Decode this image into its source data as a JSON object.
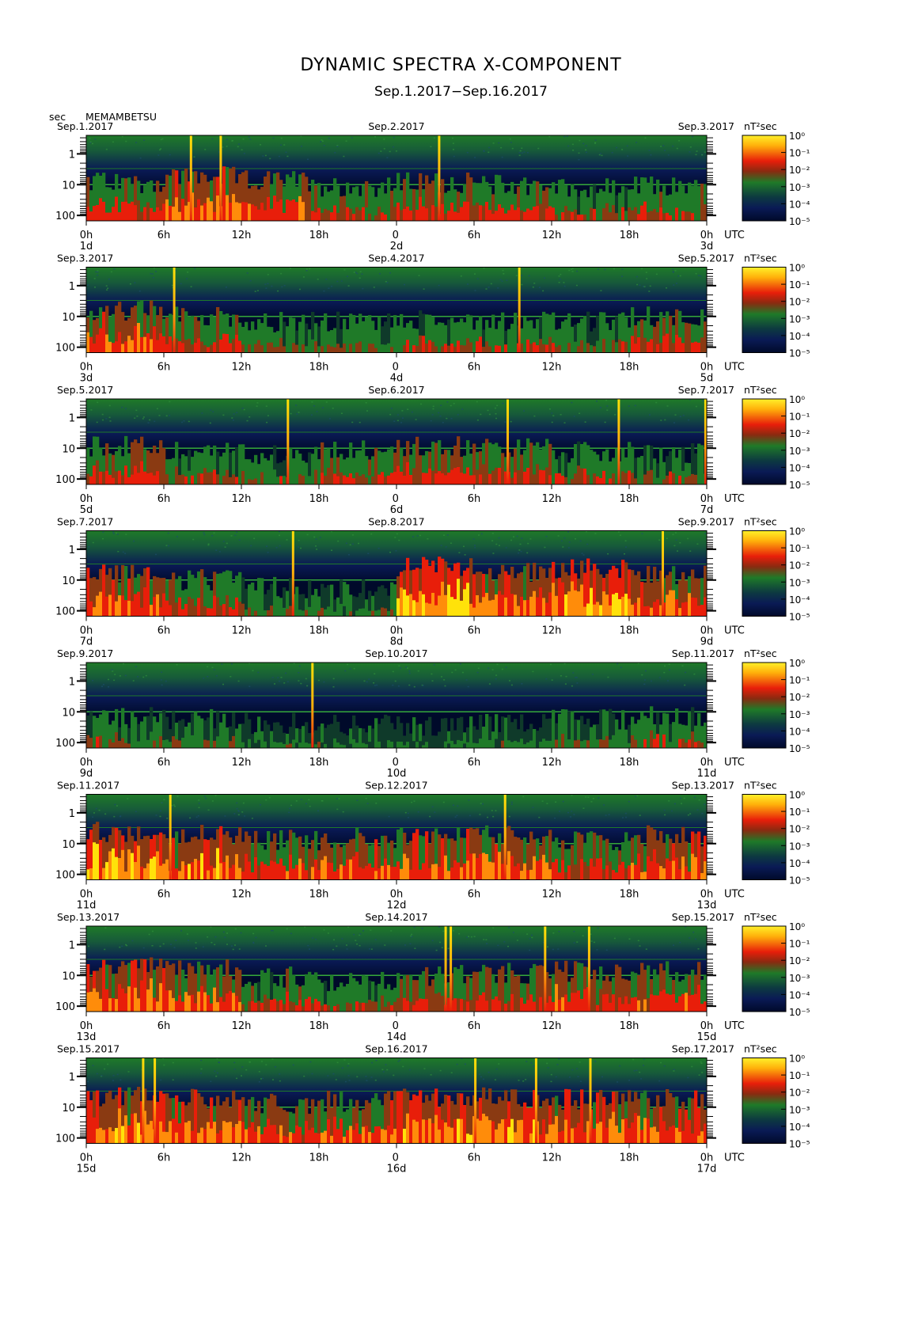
{
  "title": "DYNAMIC SPECTRA X-COMPONENT",
  "subtitle": "Sep.1.2017−Sep.16.2017",
  "y_unit": "sec",
  "station": "MEMAMBETSU",
  "colorbar_unit": "nT²sec",
  "colorbar_ticks": [
    "10⁰",
    "10⁻¹",
    "10⁻²",
    "10⁻³",
    "10⁻⁴",
    "10⁻⁵"
  ],
  "utc_label": "UTC",
  "colors": {
    "background": "#000a2a",
    "low": "#0a1a55",
    "mid": "#1f7a28",
    "high": "#e81e0a",
    "peak": "#ffe20a"
  },
  "chart_data": [
    {
      "type": "heatmap",
      "left_date": "Sep.1.2017",
      "center_date": "Sep.2.2017",
      "right_date": "Sep.3.2017",
      "x_ticks": [
        "0h",
        "6h",
        "12h",
        "18h",
        "0 ",
        "6h",
        "12h",
        "18h",
        "0h"
      ],
      "day_labels": [
        "1d",
        "2d",
        "3d"
      ],
      "y_ticks": [
        "1",
        "10",
        "100"
      ],
      "ylim_sec": [
        0.25,
        150
      ],
      "x_hours": [
        0,
        48
      ],
      "z_range": [
        "10⁻⁵",
        "10⁰"
      ],
      "spikes_hours": [
        8.1,
        10.4,
        27.3
      ],
      "activity": [
        0.55,
        0.7,
        0.6,
        0.45,
        0.55,
        0.5,
        0.4,
        0.45
      ]
    },
    {
      "type": "heatmap",
      "left_date": "Sep.3.2017",
      "center_date": "Sep.4.2017",
      "right_date": "Sep.5.2017",
      "x_ticks": [
        "0h",
        "6h",
        "12h",
        "18h",
        "0 ",
        "6h",
        "12h",
        "18h",
        "0h"
      ],
      "day_labels": [
        "3d",
        "4d",
        "5d"
      ],
      "y_ticks": [
        "1",
        "10",
        "100"
      ],
      "ylim_sec": [
        0.25,
        150
      ],
      "x_hours": [
        0,
        48
      ],
      "z_range": [
        "10⁻⁵",
        "10⁰"
      ],
      "spikes_hours": [
        6.8,
        33.5
      ],
      "activity": [
        0.65,
        0.5,
        0.35,
        0.35,
        0.4,
        0.4,
        0.35,
        0.5
      ]
    },
    {
      "type": "heatmap",
      "left_date": "Sep.5.2017",
      "center_date": "Sep.6.2017",
      "right_date": "Sep.7.2017",
      "x_ticks": [
        "0h",
        "6h",
        "12h",
        "18h",
        "0 ",
        "6h",
        "12h",
        "18h",
        "0h"
      ],
      "day_labels": [
        "5d",
        "6d",
        "7d"
      ],
      "y_ticks": [
        "1",
        "10",
        "100"
      ],
      "ylim_sec": [
        0.25,
        150
      ],
      "x_hours": [
        0,
        48
      ],
      "z_range": [
        "10⁻⁵",
        "10⁰"
      ],
      "spikes_hours": [
        15.6,
        32.6,
        41.2,
        47.9
      ],
      "activity": [
        0.55,
        0.4,
        0.35,
        0.45,
        0.55,
        0.5,
        0.4,
        0.35
      ]
    },
    {
      "type": "heatmap",
      "left_date": "Sep.7.2017",
      "center_date": "Sep.8.2017",
      "right_date": "Sep.9.2017",
      "x_ticks": [
        "0h",
        "6h",
        "12h",
        "18h",
        "0h",
        "6h",
        "12h",
        "18h",
        "0h"
      ],
      "day_labels": [
        "7d",
        "8d",
        "9d"
      ],
      "y_ticks": [
        "1",
        "10",
        "100"
      ],
      "ylim_sec": [
        0.25,
        150
      ],
      "x_hours": [
        0,
        48
      ],
      "z_range": [
        "10⁻⁵",
        "10⁰"
      ],
      "spikes_hours": [
        16.0,
        44.6
      ],
      "activity": [
        0.7,
        0.5,
        0.3,
        0.25,
        0.85,
        0.7,
        0.8,
        0.65
      ]
    },
    {
      "type": "heatmap",
      "left_date": "Sep.9.2017",
      "center_date": "Sep.10.2017",
      "right_date": "Sep.11.2017",
      "x_ticks": [
        "0h",
        "6h",
        "12h",
        "18h",
        "0 ",
        "6h",
        "12h",
        "18h",
        "0h"
      ],
      "day_labels": [
        "9d",
        "10d",
        "11d"
      ],
      "y_ticks": [
        "1",
        "10",
        "100"
      ],
      "ylim_sec": [
        0.25,
        150
      ],
      "x_hours": [
        0,
        48
      ],
      "z_range": [
        "10⁻⁵",
        "10⁰"
      ],
      "spikes_hours": [
        17.5
      ],
      "activity": [
        0.35,
        0.3,
        0.2,
        0.15,
        0.15,
        0.2,
        0.3,
        0.4
      ]
    },
    {
      "type": "heatmap",
      "left_date": "Sep.11.2017",
      "center_date": "Sep.12.2017",
      "right_date": "Sep.13.2017",
      "x_ticks": [
        "0h",
        "6h",
        "12h",
        "18h",
        "0h",
        "6h",
        "12h",
        "18h",
        "0h"
      ],
      "day_labels": [
        "11d",
        "12d",
        "13d"
      ],
      "y_ticks": [
        "1",
        "10",
        "100"
      ],
      "ylim_sec": [
        0.25,
        150
      ],
      "x_hours": [
        0,
        48
      ],
      "z_range": [
        "10⁻⁵",
        "10⁰"
      ],
      "spikes_hours": [
        6.5,
        32.4
      ],
      "activity": [
        0.8,
        0.75,
        0.6,
        0.65,
        0.7,
        0.7,
        0.55,
        0.7
      ]
    },
    {
      "type": "heatmap",
      "left_date": "Sep.13.2017",
      "center_date": "Sep.14.2017",
      "right_date": "Sep.15.2017",
      "x_ticks": [
        "0h",
        "6h",
        "12h",
        "18h",
        "0 ",
        "6h",
        "12h",
        "18h",
        "0h"
      ],
      "day_labels": [
        "13d",
        "14d",
        "15d"
      ],
      "y_ticks": [
        "1",
        "10",
        "100"
      ],
      "ylim_sec": [
        0.25,
        150
      ],
      "x_hours": [
        0,
        48
      ],
      "z_range": [
        "10⁻⁵",
        "10⁰"
      ],
      "spikes_hours": [
        27.8,
        28.2,
        35.5,
        38.9
      ],
      "activity": [
        0.7,
        0.65,
        0.45,
        0.35,
        0.5,
        0.55,
        0.6,
        0.6
      ]
    },
    {
      "type": "heatmap",
      "left_date": "Sep.15.2017",
      "center_date": "Sep.16.2017",
      "right_date": "Sep.17.2017",
      "x_ticks": [
        "0h",
        "6h",
        "12h",
        "18h",
        "0 ",
        "6h",
        "12h",
        "18h",
        "0h"
      ],
      "day_labels": [
        "15d",
        "16d",
        "17d"
      ],
      "y_ticks": [
        "1",
        "10",
        "100"
      ],
      "ylim_sec": [
        0.25,
        150
      ],
      "x_hours": [
        0,
        48
      ],
      "z_range": [
        "10⁻⁵",
        "10⁰"
      ],
      "spikes_hours": [
        4.4,
        5.3,
        30.1,
        34.8,
        39.0
      ],
      "activity": [
        0.75,
        0.7,
        0.6,
        0.65,
        0.75,
        0.75,
        0.7,
        0.7
      ]
    }
  ]
}
